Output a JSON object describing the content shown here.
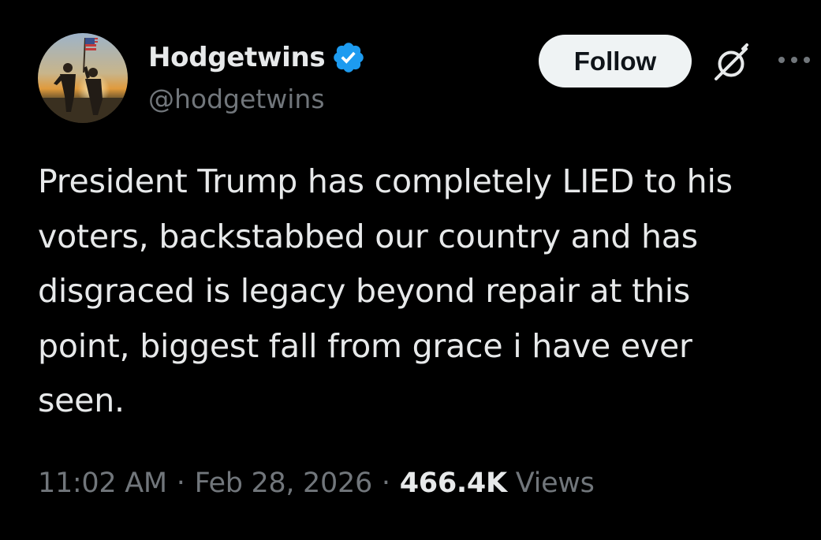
{
  "author": {
    "display_name": "Hodgetwins",
    "handle": "@hodgetwins",
    "verified": true,
    "verified_color": "#1d9bf0"
  },
  "actions": {
    "follow_label": "Follow",
    "grok_icon": "grok-icon",
    "more_icon": "more-icon"
  },
  "tweet": {
    "text": "President Trump has completely LIED to his\nvoters, backstabbed our country and has\ndisgraced is legacy beyond repair at this\npoint, biggest fall from grace i have ever\nseen."
  },
  "meta": {
    "time": "11:02 AM",
    "separator": "·",
    "date": "Feb 28, 2026",
    "views_count": "466.4K",
    "views_label": "Views"
  },
  "colors": {
    "background": "#000000",
    "text_primary": "#e7e9ea",
    "text_secondary": "#71767b",
    "button_bg": "#eff3f4",
    "button_text": "#0f1419"
  }
}
